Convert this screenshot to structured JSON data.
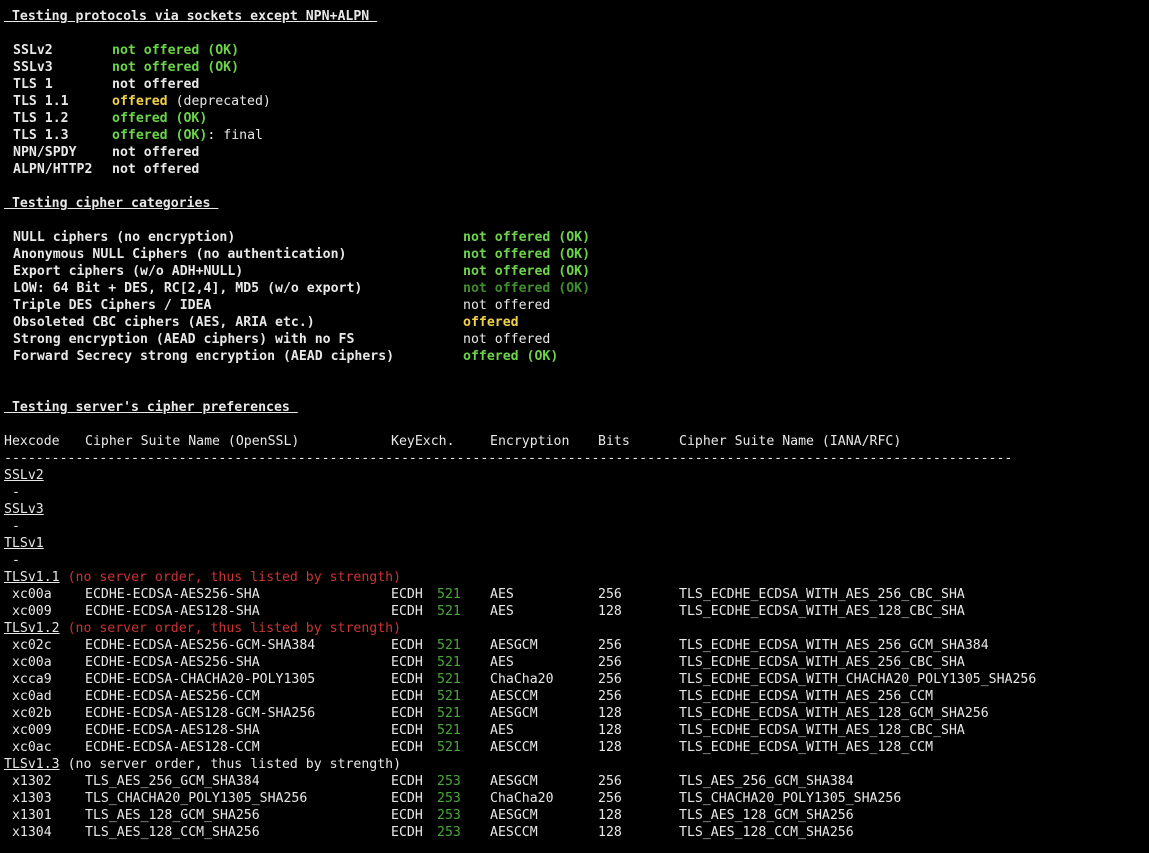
{
  "colors": {
    "background": "#000000",
    "text": "#e8e8e8",
    "ok_green": "#6bd44a",
    "dim_green": "#3f8f2e",
    "warn_yellow": "#f0d24a",
    "red": "#cc3333",
    "keyexch_green": "#4aa83a"
  },
  "protocols": {
    "header": " Testing protocols via sockets except NPN+ALPN ",
    "rows": [
      {
        "name": "SSLv2",
        "status": "not offered (OK)",
        "cls": "ok"
      },
      {
        "name": "SSLv3",
        "status": "not offered (OK)",
        "cls": "ok"
      },
      {
        "name": "TLS 1",
        "status": "not offered",
        "cls": "plain"
      },
      {
        "name": "TLS 1.1",
        "status": "offered",
        "extra": " (deprecated)",
        "cls": "warn"
      },
      {
        "name": "TLS 1.2",
        "status": "offered (OK)",
        "cls": "ok"
      },
      {
        "name": "TLS 1.3",
        "status": "offered (OK)",
        "extra": ": final",
        "cls": "ok"
      },
      {
        "name": "NPN/SPDY",
        "status": "not offered",
        "cls": "plain"
      },
      {
        "name": "ALPN/HTTP2",
        "status": "not offered",
        "cls": "plain"
      }
    ]
  },
  "categories": {
    "header": " Testing cipher categories ",
    "rows": [
      {
        "name": "NULL ciphers (no encryption)",
        "status": "not offered (OK)",
        "cls": "ok"
      },
      {
        "name": "Anonymous NULL Ciphers (no authentication)",
        "status": "not offered (OK)",
        "cls": "ok"
      },
      {
        "name": "Export ciphers (w/o ADH+NULL)",
        "status": "not offered (OK)",
        "cls": "ok"
      },
      {
        "name": "LOW: 64 Bit + DES, RC[2,4], MD5 (w/o export)",
        "status": "not offered (OK)",
        "cls": "dim"
      },
      {
        "name": "Triple DES Ciphers / IDEA",
        "status": "not offered",
        "cls": "plain"
      },
      {
        "name": "Obsoleted CBC ciphers (AES, ARIA etc.)",
        "status": "offered",
        "cls": "warn"
      },
      {
        "name": "Strong encryption (AEAD ciphers) with no FS",
        "status": "not offered",
        "cls": "plain"
      },
      {
        "name": "Forward Secrecy strong encryption (AEAD ciphers)",
        "status": "offered (OK)",
        "cls": "ok"
      }
    ]
  },
  "preferences": {
    "header": " Testing server's cipher preferences ",
    "columns": {
      "hex": "Hexcode",
      "openssl": "Cipher Suite Name (OpenSSL)",
      "kx": "KeyExch.",
      "enc": "Encryption",
      "bits": "Bits",
      "iana": "Cipher Suite Name (IANA/RFC)"
    },
    "separator": "-------------------------------------------------------------------------------------------------------------------------------",
    "dash": " -",
    "groups": [
      {
        "proto": "SSLv2",
        "note": "",
        "rows": []
      },
      {
        "proto": "SSLv3",
        "note": "",
        "rows": []
      },
      {
        "proto": "TLSv1",
        "note": "",
        "rows": []
      },
      {
        "proto": "TLSv1.1",
        "note": " (no server order, thus listed by strength)",
        "note_cls": "red",
        "rows": [
          {
            "hex": " xc00a",
            "openssl": "ECDHE-ECDSA-AES256-SHA",
            "kx": "ECDH",
            "kx_bits": "521",
            "enc": "AES",
            "bits": "256",
            "iana": "TLS_ECDHE_ECDSA_WITH_AES_256_CBC_SHA"
          },
          {
            "hex": " xc009",
            "openssl": "ECDHE-ECDSA-AES128-SHA",
            "kx": "ECDH",
            "kx_bits": "521",
            "enc": "AES",
            "bits": "128",
            "iana": "TLS_ECDHE_ECDSA_WITH_AES_128_CBC_SHA"
          }
        ]
      },
      {
        "proto": "TLSv1.2",
        "note": " (no server order, thus listed by strength)",
        "note_cls": "red",
        "rows": [
          {
            "hex": " xc02c",
            "openssl": "ECDHE-ECDSA-AES256-GCM-SHA384",
            "kx": "ECDH",
            "kx_bits": "521",
            "enc": "AESGCM",
            "bits": "256",
            "iana": "TLS_ECDHE_ECDSA_WITH_AES_256_GCM_SHA384"
          },
          {
            "hex": " xc00a",
            "openssl": "ECDHE-ECDSA-AES256-SHA",
            "kx": "ECDH",
            "kx_bits": "521",
            "enc": "AES",
            "bits": "256",
            "iana": "TLS_ECDHE_ECDSA_WITH_AES_256_CBC_SHA"
          },
          {
            "hex": " xcca9",
            "openssl": "ECDHE-ECDSA-CHACHA20-POLY1305",
            "kx": "ECDH",
            "kx_bits": "521",
            "enc": "ChaCha20",
            "bits": "256",
            "iana": "TLS_ECDHE_ECDSA_WITH_CHACHA20_POLY1305_SHA256"
          },
          {
            "hex": " xc0ad",
            "openssl": "ECDHE-ECDSA-AES256-CCM",
            "kx": "ECDH",
            "kx_bits": "521",
            "enc": "AESCCM",
            "bits": "256",
            "iana": "TLS_ECDHE_ECDSA_WITH_AES_256_CCM"
          },
          {
            "hex": " xc02b",
            "openssl": "ECDHE-ECDSA-AES128-GCM-SHA256",
            "kx": "ECDH",
            "kx_bits": "521",
            "enc": "AESGCM",
            "bits": "128",
            "iana": "TLS_ECDHE_ECDSA_WITH_AES_128_GCM_SHA256"
          },
          {
            "hex": " xc009",
            "openssl": "ECDHE-ECDSA-AES128-SHA",
            "kx": "ECDH",
            "kx_bits": "521",
            "enc": "AES",
            "bits": "128",
            "iana": "TLS_ECDHE_ECDSA_WITH_AES_128_CBC_SHA"
          },
          {
            "hex": " xc0ac",
            "openssl": "ECDHE-ECDSA-AES128-CCM",
            "kx": "ECDH",
            "kx_bits": "521",
            "enc": "AESCCM",
            "bits": "128",
            "iana": "TLS_ECDHE_ECDSA_WITH_AES_128_CCM"
          }
        ]
      },
      {
        "proto": "TLSv1.3",
        "note": " (no server order, thus listed by strength)",
        "note_cls": "plain",
        "rows": [
          {
            "hex": " x1302",
            "openssl": "TLS_AES_256_GCM_SHA384",
            "kx": "ECDH",
            "kx_bits": "253",
            "enc": "AESGCM",
            "bits": "256",
            "iana": "TLS_AES_256_GCM_SHA384"
          },
          {
            "hex": " x1303",
            "openssl": "TLS_CHACHA20_POLY1305_SHA256",
            "kx": "ECDH",
            "kx_bits": "253",
            "enc": "ChaCha20",
            "bits": "256",
            "iana": "TLS_CHACHA20_POLY1305_SHA256"
          },
          {
            "hex": " x1301",
            "openssl": "TLS_AES_128_GCM_SHA256",
            "kx": "ECDH",
            "kx_bits": "253",
            "enc": "AESGCM",
            "bits": "128",
            "iana": "TLS_AES_128_GCM_SHA256"
          },
          {
            "hex": " x1304",
            "openssl": "TLS_AES_128_CCM_SHA256",
            "kx": "ECDH",
            "kx_bits": "253",
            "enc": "AESCCM",
            "bits": "128",
            "iana": "TLS_AES_128_CCM_SHA256"
          }
        ]
      }
    ]
  }
}
